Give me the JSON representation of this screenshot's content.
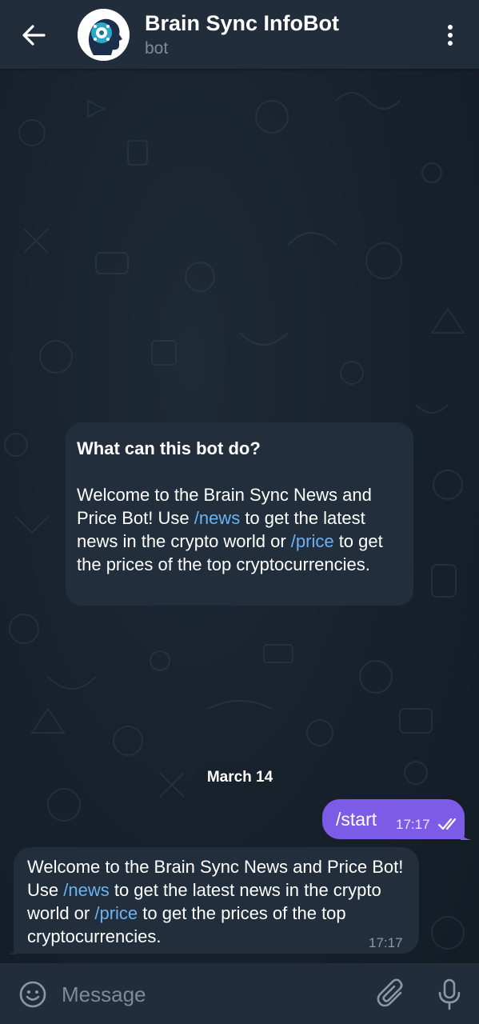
{
  "header": {
    "title": "Brain Sync InfoBot",
    "subtitle": "bot",
    "icons": [
      "back-arrow-icon",
      "bot-avatar",
      "more-vertical-icon"
    ]
  },
  "info_card": {
    "heading": "What can this bot do?",
    "text_parts": [
      "Welcome to the Brain Sync News and Price Bot! Use ",
      "/news",
      " to get the latest news in the crypto world or ",
      "/price",
      " to get the prices of the top cryptocurrencies."
    ]
  },
  "date_chip": "March 14",
  "messages": [
    {
      "direction": "outgoing",
      "text": "/start",
      "time": "17:17",
      "status": "read"
    },
    {
      "direction": "incoming",
      "text_parts": [
        "Welcome to the Brain Sync News and Price Bot! Use ",
        "/news",
        " to get the latest news in the crypto world or ",
        "/price",
        " to get the prices of the top cryptocurrencies."
      ],
      "time": "17:17"
    }
  ],
  "input": {
    "placeholder": "Message",
    "icons": [
      "emoji-icon",
      "attach-paperclip-icon",
      "microphone-icon"
    ]
  },
  "colors": {
    "header_bg": "#212d3b",
    "chat_bg": "#17212c",
    "bubble_in": "#222e3b",
    "bubble_out": "#7c5ce6",
    "link": "#6ab3f3"
  }
}
